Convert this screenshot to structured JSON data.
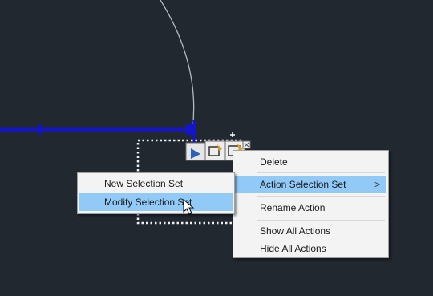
{
  "context_menu": {
    "items": [
      {
        "label": "Delete"
      },
      {
        "label": "Action Selection Set",
        "has_submenu": true,
        "highlighted": true
      },
      {
        "label": "Rename Action"
      },
      {
        "label": "Show All Actions"
      },
      {
        "label": "Hide All Actions"
      }
    ],
    "submenu_arrow": ">"
  },
  "submenu": {
    "items": [
      {
        "label": "New Selection Set"
      },
      {
        "label": "Modify Selection Set",
        "highlighted": true
      }
    ]
  },
  "colors": {
    "background": "#212830",
    "parameter_line": "#1515c8",
    "arc": "#b8b8b8",
    "selection_box": "#f0f0f0",
    "menu_highlight": "#91c9f7"
  }
}
